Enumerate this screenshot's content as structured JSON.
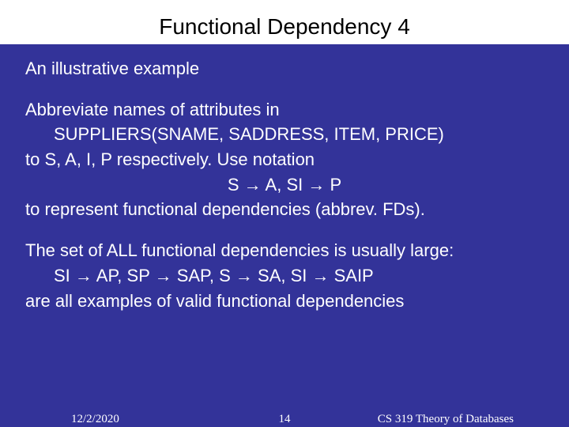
{
  "title": "Functional Dependency 4",
  "body": {
    "p1": "An illustrative example",
    "p2": "Abbreviate names of attributes in",
    "p3": "SUPPLIERS(SNAME, SADDRESS, ITEM, PRICE)",
    "p4": "to S, A, I, P respectively. Use notation",
    "p5": "S → A, SI → P",
    "p6": "to represent functional dependencies (abbrev. FDs).",
    "p7": "The set of ALL functional dependencies is usually large:",
    "p8": "SI → AP, SP → SAP, S → SA, SI → SAIP",
    "p9": "are all examples of valid functional dependencies"
  },
  "footer": {
    "date": "12/2/2020",
    "page": "14",
    "course": "CS 319 Theory of Databases"
  }
}
